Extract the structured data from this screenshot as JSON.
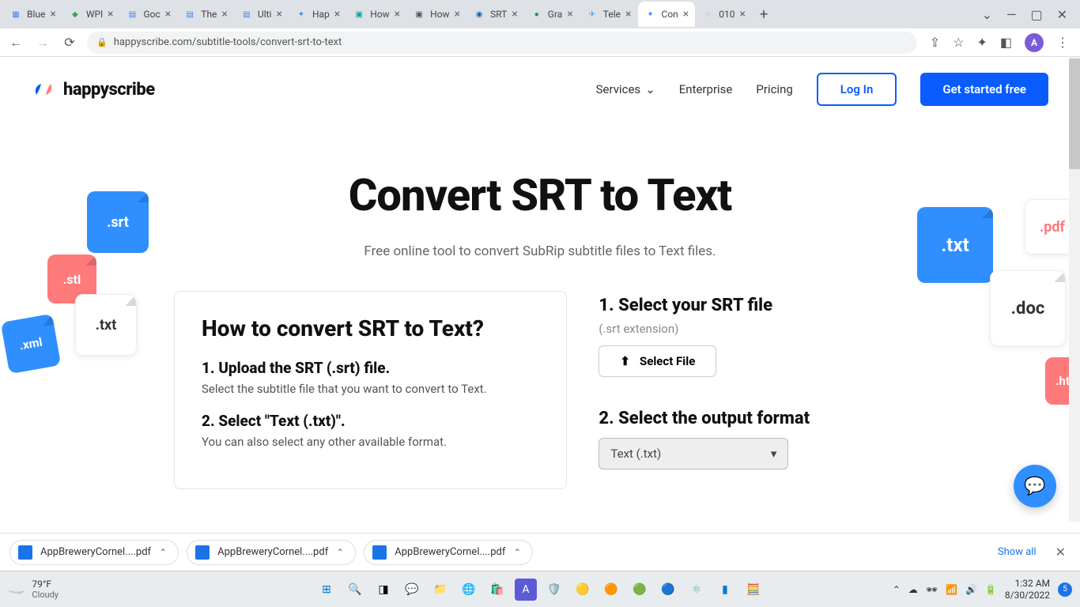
{
  "browser": {
    "tabs": [
      {
        "title": "Blue",
        "favicon_color": "#4285f4"
      },
      {
        "title": "WPl",
        "favicon_color": "#34a853"
      },
      {
        "title": "Goc",
        "favicon_color": "#4285f4"
      },
      {
        "title": "The",
        "favicon_color": "#4285f4"
      },
      {
        "title": "Ulti",
        "favicon_color": "#4285f4"
      },
      {
        "title": "Hap",
        "favicon_color": "#2f8fff"
      },
      {
        "title": "How",
        "favicon_color": "#00a8a8"
      },
      {
        "title": "How",
        "favicon_color": "#555"
      },
      {
        "title": "SRT",
        "favicon_color": "#1a5fb4"
      },
      {
        "title": "Gra",
        "favicon_color": "#0a9d58"
      },
      {
        "title": "Tele",
        "favicon_color": "#29a9eb"
      },
      {
        "title": "Con",
        "favicon_color": "#2f8fff",
        "active": true
      },
      {
        "title": "010",
        "favicon_color": "#888"
      }
    ],
    "url": "happyscribe.com/subtitle-tools/convert-srt-to-text",
    "avatar_letter": "A"
  },
  "header": {
    "brand": "happyscribe",
    "nav": {
      "services": "Services",
      "enterprise": "Enterprise",
      "pricing": "Pricing"
    },
    "login_label": "Log In",
    "cta_label": "Get started free"
  },
  "hero": {
    "title": "Convert SRT to Text",
    "subtitle": "Free online tool to convert SubRip subtitle files to Text files."
  },
  "decor": {
    "srt": ".srt",
    "stl": ".stl",
    "txt1": ".txt",
    "xml": ".xml",
    "txt2": ".txt",
    "pdf": ".pdf",
    "doc": ".doc",
    "ht": ".ht"
  },
  "howcard": {
    "title": "How to convert SRT to Text?",
    "step1_h": "1. Upload the SRT (.srt) file.",
    "step1_p": "Select the subtitle file that you want to convert to Text.",
    "step2_h": "2. Select \"Text (.txt)\".",
    "step2_p": "You can also select any other available format."
  },
  "sidesteps": {
    "step1_h": "1.  Select your SRT file",
    "step1_hint": "(.srt extension)",
    "select_file_label": "Select File",
    "step2_h": "2. Select the output format",
    "format_value": "Text (.txt)"
  },
  "downloads": {
    "items": [
      {
        "name": "AppBreweryCornel....pdf"
      },
      {
        "name": "AppBreweryCornel....pdf"
      },
      {
        "name": "AppBreweryCornel....pdf"
      }
    ],
    "show_all": "Show all"
  },
  "taskbar": {
    "temp": "79°F",
    "cond": "Cloudy",
    "time": "1:32 AM",
    "date": "8/30/2022",
    "badge": "5"
  }
}
